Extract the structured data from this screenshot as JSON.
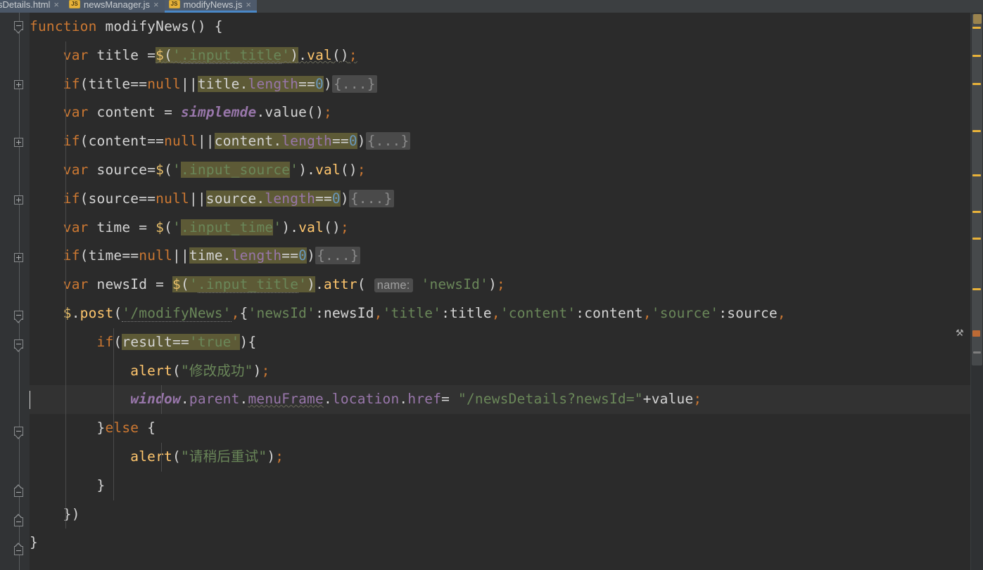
{
  "window": {
    "app": "IntelliJ IDEA Editor",
    "theme": "Darcula",
    "colors": {
      "editor_bg": "#2b2b2b",
      "gutter_bg": "#313335",
      "tabbar_bg": "#3c3f41",
      "tab_bg": "#4b5767",
      "active_tab_underline": "#4a88c7",
      "keyword": "#cc7832",
      "string": "#6a8759",
      "number": "#6897bb",
      "function": "#ffc66d",
      "global_var": "#9876aa",
      "identifier": "#a9b7c6",
      "search_highlight": "#5d5a36",
      "folded_region": "#4a4a4a",
      "warning_marker": "#e8b23a",
      "current_line": "#323232"
    }
  },
  "tabs": [
    {
      "label": "sDetails.html",
      "icon": "html-file-icon",
      "active": false,
      "close": "×"
    },
    {
      "label": "newsManager.js",
      "icon": "js-file-icon",
      "active": false,
      "close": "×"
    },
    {
      "label": "modifyNews.js",
      "icon": "js-file-icon",
      "active": true,
      "close": "×"
    }
  ],
  "code": {
    "language": "JavaScript",
    "file": "modifyNews.js",
    "lines": [
      "function modifyNews() {",
      "    var title =$('.input_title').val();",
      "    if(title==null||title.length==0){...}",
      "    var content = simplemde.value();",
      "    if(content==null||content.length==0){...}",
      "    var source=$('.input_source').val();",
      "    if(source==null||source.length==0){...}",
      "    var time = $('.input_time').val();",
      "    if(time==null||time.length==0){...}",
      "    var newsId = $('.input_title').attr( name: 'newsId');",
      "    $.post('/modifyNews',{'newsId':newsId,'title':title,'content':content,'source':source,",
      "        if(result=='true'){",
      "            alert(\"修改成功\");",
      "            window.parent.menuFrame.location.href= \"/newsDetails?newsId=\"+value;",
      "        }else {",
      "            alert(\"请稍后重试\");",
      "        }",
      "    })",
      "}"
    ],
    "inlay_hints": [
      {
        "line": 9,
        "text": "name:"
      }
    ],
    "folded_placeholders": [
      "{...}"
    ],
    "search_highlights": [
      "$('.input_title')",
      "title.length==0",
      "content.length==0",
      "'.input_source'",
      "source.length==0",
      "'.input_time'",
      "time.length==0",
      "$('.input_title')",
      "result=='true'"
    ],
    "caret_line": 13,
    "strings": [
      "'.input_title'",
      "'.input_source'",
      "'.input_time'",
      "'newsId'",
      "'/modifyNews'",
      "'title'",
      "'content'",
      "'source'",
      "'true'",
      "\"修改成功\"",
      "\"/newsDetails?newsId=\"",
      "\"请稍后重试\""
    ],
    "keywords": [
      "function",
      "var",
      "if",
      "else"
    ],
    "functions": [
      "modifyNews",
      "alert",
      "post",
      "val",
      "attr",
      "value"
    ],
    "globals": [
      "simplemde",
      "window"
    ]
  },
  "gutter": {
    "fold_markers": [
      {
        "line": 0,
        "state": "expanded",
        "icon": "fold-collapse-icon"
      },
      {
        "line": 2,
        "state": "collapsed",
        "icon": "fold-expand-icon"
      },
      {
        "line": 4,
        "state": "collapsed",
        "icon": "fold-expand-icon"
      },
      {
        "line": 6,
        "state": "collapsed",
        "icon": "fold-expand-icon"
      },
      {
        "line": 8,
        "state": "collapsed",
        "icon": "fold-expand-icon"
      },
      {
        "line": 10,
        "state": "expanded",
        "icon": "fold-collapse-icon"
      },
      {
        "line": 11,
        "state": "expanded",
        "icon": "fold-collapse-icon"
      },
      {
        "line": 14,
        "state": "expanded",
        "icon": "fold-collapse-icon"
      },
      {
        "line": 16,
        "state": "end",
        "icon": "fold-end-icon"
      },
      {
        "line": 17,
        "state": "end",
        "icon": "fold-end-icon"
      },
      {
        "line": 18,
        "state": "end",
        "icon": "fold-end-icon"
      }
    ]
  },
  "marker_bar": {
    "inspection_summary_icon": "warning-summary-icon",
    "warning_markers": 9,
    "error_markers": 1
  }
}
